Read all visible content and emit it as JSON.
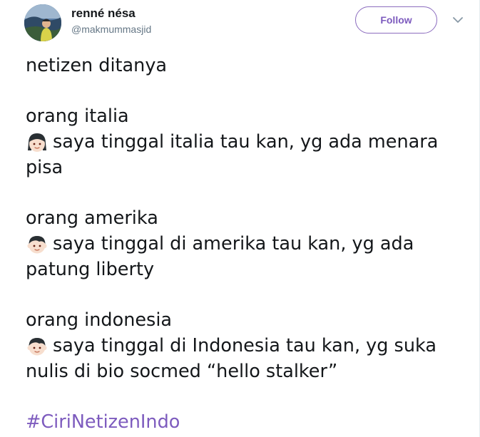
{
  "user": {
    "display_name": "renné nésa",
    "handle": "@makmummasjid"
  },
  "header": {
    "follow_label": "Follow"
  },
  "tweet": {
    "line_1": "netizen ditanya",
    "block_italia_heading": "orang italia",
    "block_italia_line_1": "saya tinggal italia tau kan, yg ada menara",
    "block_italia_line_2": "pisa",
    "block_amerika_heading": "orang amerika",
    "block_amerika_line_1": "saya tinggal di amerika tau kan, yg ada",
    "block_amerika_line_2": "patung liberty",
    "block_indonesia_heading": "orang indonesia",
    "block_indonesia_line_1": "saya tinggal di Indonesia tau kan, yg suka",
    "block_indonesia_line_2": "nulis di bio socmed “hello stalker”",
    "hashtag": "#CiriNetizenIndo"
  },
  "icons": {
    "avatar": "profile-photo",
    "caret": "chevron-down-icon",
    "emoji_italia": "girl-face-emoji",
    "emoji_amerika": "boy-face-emoji",
    "emoji_indonesia": "boy-face-emoji"
  },
  "colors": {
    "accent": "#7d5bbe",
    "text": "#14171a",
    "secondary": "#657786"
  }
}
